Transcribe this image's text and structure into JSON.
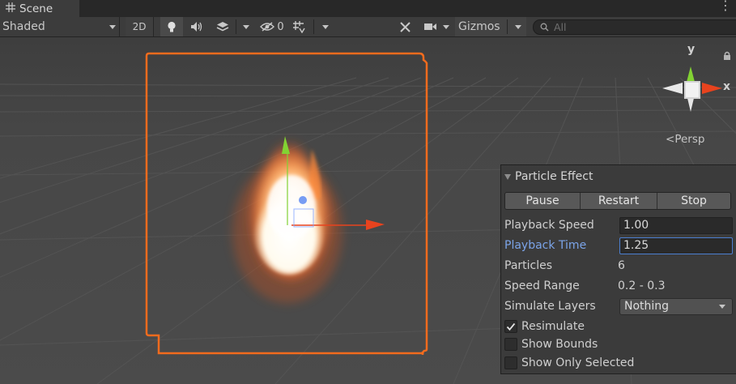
{
  "tab": {
    "title": "Scene"
  },
  "toolbar": {
    "shading_mode": "Shaded",
    "mode_2d": "2D",
    "hidden_count": "0",
    "gizmos_label": "Gizmos",
    "search_placeholder": "All"
  },
  "orientation": {
    "y_axis": "y",
    "x_axis": "x",
    "projection": "Persp"
  },
  "particle_panel": {
    "title": "Particle Effect",
    "buttons": {
      "pause": "Pause",
      "restart": "Restart",
      "stop": "Stop"
    },
    "fields": {
      "playback_speed_label": "Playback Speed",
      "playback_speed_value": "1.00",
      "playback_time_label": "Playback Time",
      "playback_time_value": "1.25",
      "particles_label": "Particles",
      "particles_value": "6",
      "speed_range_label": "Speed Range",
      "speed_range_value": "0.2 - 0.3",
      "simulate_layers_label": "Simulate Layers",
      "simulate_layers_value": "Nothing"
    },
    "toggles": {
      "resimulate": "Resimulate",
      "show_bounds": "Show Bounds",
      "show_only_selected": "Show Only Selected"
    },
    "toggle_states": {
      "resimulate": true,
      "show_bounds": false,
      "show_only_selected": false
    }
  },
  "colors": {
    "selection_outline": "#f26b1d",
    "accent_blue": "#4b7fd1",
    "x_axis": "#e8431e",
    "y_axis": "#82d233"
  }
}
